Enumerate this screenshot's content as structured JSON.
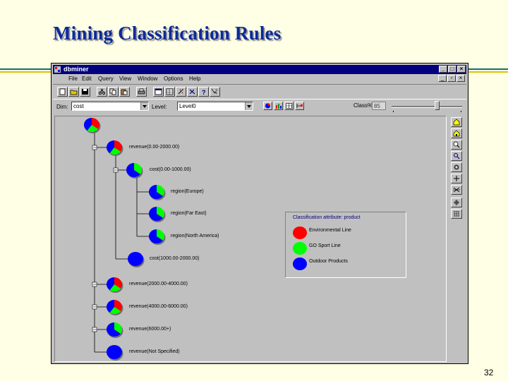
{
  "slide": {
    "title": "Mining Classification Rules",
    "page_number": "32"
  },
  "window": {
    "title": "dbminer",
    "menu": [
      "File",
      "Edit",
      "Query",
      "View",
      "Window",
      "Options",
      "Help"
    ]
  },
  "dimbar": {
    "dim_label": "Dim:",
    "dim_value": "cost",
    "level_label": "Level:",
    "level_value": "Level0",
    "class_label": "Class%",
    "class_value": "85",
    "class_level": 0.62
  },
  "tree": {
    "nodes": [
      {
        "id": "root",
        "label": ""
      },
      {
        "id": "rev1",
        "label": "revenue(0.00-2000.00)"
      },
      {
        "id": "cost1",
        "label": "cost(0.00-1000.00)"
      },
      {
        "id": "reg1",
        "label": "region(Europe)"
      },
      {
        "id": "reg2",
        "label": "region(Far East)"
      },
      {
        "id": "reg3",
        "label": "region(North America)"
      },
      {
        "id": "cost2",
        "label": "cost(1000.00-2000.00)"
      },
      {
        "id": "rev2",
        "label": "revenue(2000.00-4000.00)"
      },
      {
        "id": "rev3",
        "label": "revenue(4000.00-6000.00)"
      },
      {
        "id": "rev4",
        "label": "revenue(6000.00+)"
      },
      {
        "id": "rev5",
        "label": "revenue(Not Specified)"
      }
    ]
  },
  "legend": {
    "title": "Classification attribute: product",
    "items": [
      {
        "label": "Environmental Line",
        "color": "#ff0000"
      },
      {
        "label": "GO Sport Line",
        "color": "#00ff00"
      },
      {
        "label": "Outdoor Products",
        "color": "#0000ff"
      }
    ]
  },
  "colors": {
    "title": "#0b2a99",
    "red": "#ff0000",
    "green": "#00ff00",
    "blue": "#0000ff"
  }
}
